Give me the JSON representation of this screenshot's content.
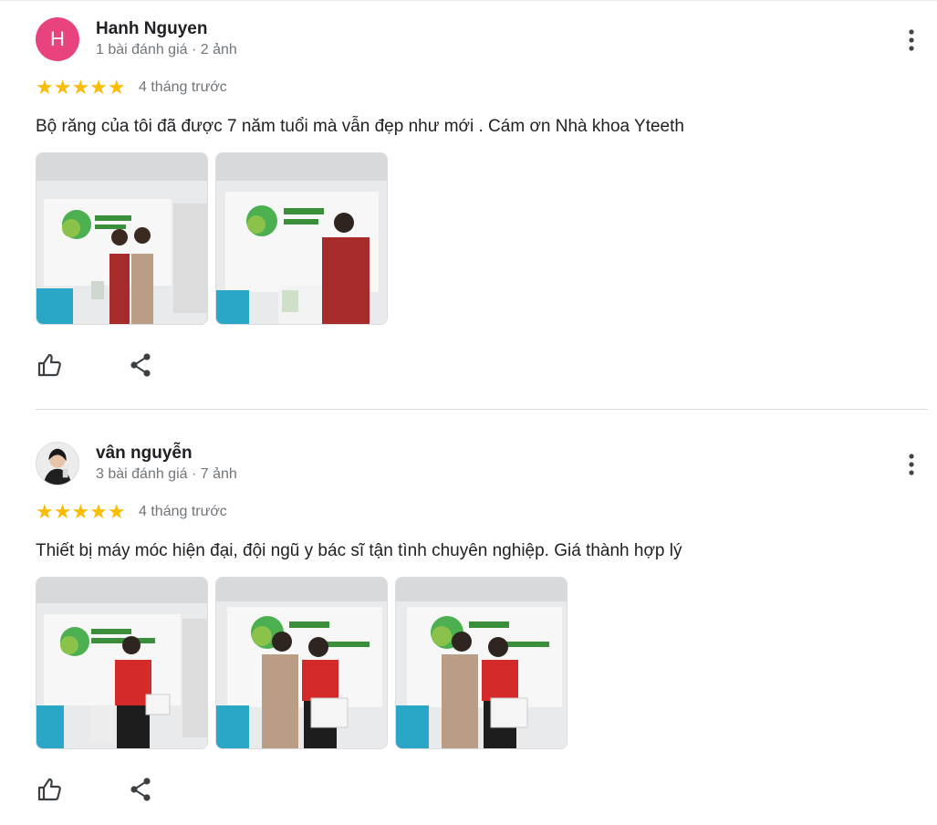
{
  "reviews": [
    {
      "avatar_letter": "H",
      "avatar_color": "#e9437f",
      "name": "Hanh Nguyen",
      "meta": "1 bài đánh giá · 2 ảnh",
      "rating": 5,
      "stars": "★★★★★",
      "time": "4 tháng trước",
      "text": "Bộ răng của tôi đã được 7 năm tuổi mà vẫn đẹp như mới . Cám ơn Nhà khoa Yteeth",
      "photo_count": 2
    },
    {
      "avatar_letter": "",
      "name": "vân nguyễn",
      "meta": "3 bài đánh giá · 7 ảnh",
      "rating": 5,
      "stars": "★★★★★",
      "time": "4 tháng trước",
      "text": "Thiết bị máy móc hiện đại, đội ngũ y bác sĩ tận tình chuyên nghiệp. Giá thành hợp lý",
      "photo_count": 3
    }
  ],
  "colors": {
    "star": "#fbbc04",
    "meta_gray": "#70757a",
    "divider": "#dadce0"
  },
  "icons": {
    "more": "more-vert-icon",
    "like": "thumb-up-icon",
    "share": "share-icon"
  }
}
